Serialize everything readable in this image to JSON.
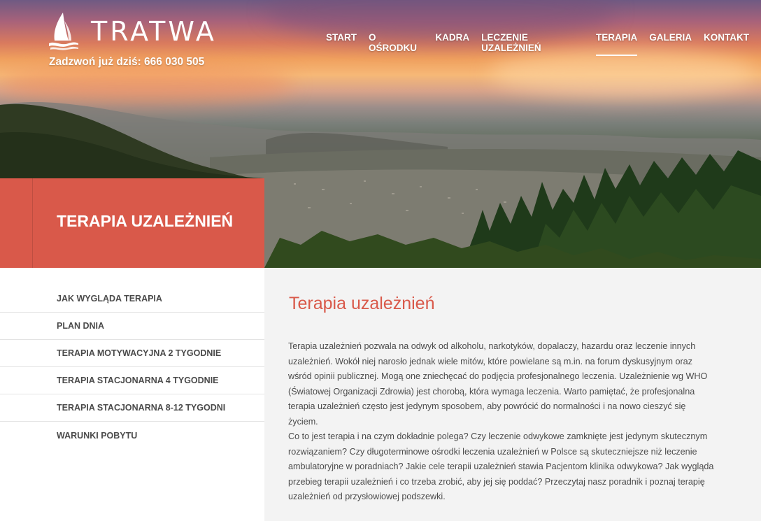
{
  "header": {
    "logo_text": "TRATWA",
    "phone": "Zadzwoń już dziś: 666 030 505",
    "nav": [
      {
        "label": "START",
        "active": false
      },
      {
        "label": "O OŚRODKU",
        "active": false
      },
      {
        "label": "KADRA",
        "active": false
      },
      {
        "label": "LECZENIE UZALEŻNIEŃ",
        "active": false
      },
      {
        "label": "TERAPIA",
        "active": true
      },
      {
        "label": "GALERIA",
        "active": false
      },
      {
        "label": "KONTAKT",
        "active": false
      }
    ]
  },
  "hero": {
    "title": "TERAPIA UZALEŻNIEŃ"
  },
  "sidebar": {
    "items": [
      {
        "label": "JAK WYGLĄDA TERAPIA"
      },
      {
        "label": "PLAN DNIA"
      },
      {
        "label": "TERAPIA MOTYWACYJNA 2 TYGODNIE"
      },
      {
        "label": "TERAPIA STACJONARNA 4 TYGODNIE"
      },
      {
        "label": "TERAPIA STACJONARNA 8-12 TYGODNI"
      },
      {
        "label": "WARUNKI POBYTU"
      }
    ]
  },
  "main": {
    "heading": "Terapia uzależnień",
    "paragraphs": [
      "Terapia uzależnień pozwala na odwyk od alkoholu, narkotyków, dopalaczy, hazardu oraz leczenie innych uzależnień.  Wokół niej narosło jednak wiele mitów, które powielane są m.in. na forum dyskusyjnym oraz wśród opinii publicznej. Mogą one zniechęcać do podjęcia profesjonalnego leczenia. Uzależnienie wg WHO (Światowej Organizacji Zdrowia) jest chorobą, która wymaga leczenia. Warto pamiętać, że profesjonalna terapia uzależnień często jest jedynym sposobem, aby powrócić do normalności i na nowo cieszyć się życiem.",
      "Co to jest terapia i na czym dokładnie polega? Czy leczenie odwykowe zamknięte jest jedynym skutecznym rozwiązaniem? Czy długoterminowe ośrodki leczenia uzależnień w Polsce są skuteczniejsze niż  leczenie ambulatoryjne w poradniach? Jakie cele terapii uzależnień stawia Pacjentom klinika odwykowa? Jak wygląda przebieg terapii uzależnień i co trzeba zrobić, aby jej się poddać? Przeczytaj nasz poradnik i poznaj terapię uzależnień od przysłowiowej podszewki."
    ]
  },
  "colors": {
    "accent": "#d9594a",
    "content_bg": "#f3f3f3",
    "text": "#4b4b4b"
  }
}
